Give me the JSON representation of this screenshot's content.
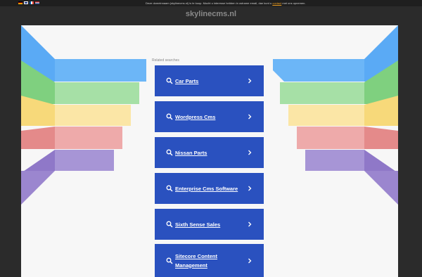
{
  "topbar": {
    "languages": [
      "de",
      "en",
      "fr",
      "nl"
    ],
    "notice_prefix": "Deze domeinnaam (skylinecms.nl) is te koop. Mocht u interesse hebben in ostrame emaiI, dan kunt u",
    "contact_link": "contact",
    "notice_suffix": "met ons opnemen."
  },
  "site": {
    "domain": "skylinecms.nl"
  },
  "main": {
    "related_heading": "Related searches",
    "searches": [
      {
        "label": "Car Parts"
      },
      {
        "label": "Wordpress Cms"
      },
      {
        "label": "Nissan Parts"
      },
      {
        "label": "Enterprise Cms Software"
      },
      {
        "label": "Sixth Sense Sales"
      },
      {
        "label": "Sitecore Content Management"
      }
    ]
  },
  "colors": {
    "page_bg": "#2b2b2b",
    "panel_bg": "#f7f7f7",
    "card_bg": "#2a51bf",
    "link_accent": "#f0a020",
    "ribbon_blue": "#5aaaf5",
    "ribbon_green": "#86d68a",
    "ribbon_yellow": "#fbe29a",
    "ribbon_red": "#e89a9a",
    "ribbon_purple": "#9b86cf"
  }
}
